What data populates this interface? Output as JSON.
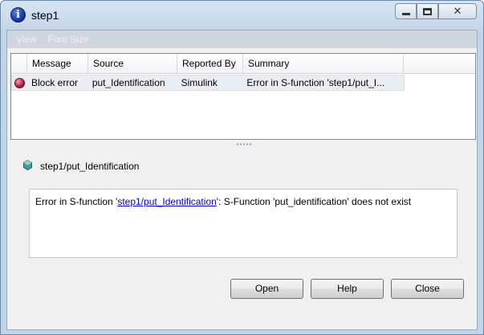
{
  "window": {
    "title": "step1",
    "icon": "info-icon",
    "controls": {
      "minimize": "minimize-icon",
      "maximize": "maximize-icon",
      "close": "✕"
    }
  },
  "menu": {
    "items": [
      {
        "label": "View"
      },
      {
        "label": "Font Size"
      }
    ]
  },
  "table": {
    "columns": [
      "Message",
      "Source",
      "Reported By",
      "Summary"
    ],
    "rows": [
      {
        "icon": "error-icon",
        "message": "Block error",
        "source": "put_Identification",
        "reported_by": "Simulink",
        "summary": "Error in S-function 'step1/put_I..."
      }
    ]
  },
  "details": {
    "icon": "block-icon",
    "title": "step1/put_Identification",
    "message_prefix": "Error in S-function '",
    "message_link": "step1/put_Identification",
    "message_suffix": "': S-Function 'put_identification' does not exist"
  },
  "buttons": {
    "open": "Open",
    "help": "Help",
    "close": "Close"
  },
  "colors": {
    "title_bar": "#c5d6e9",
    "menu_bar": "#cfd6e0",
    "selected_row": "#e9eef5",
    "link": "#0000cc",
    "error": "#a4123e"
  }
}
